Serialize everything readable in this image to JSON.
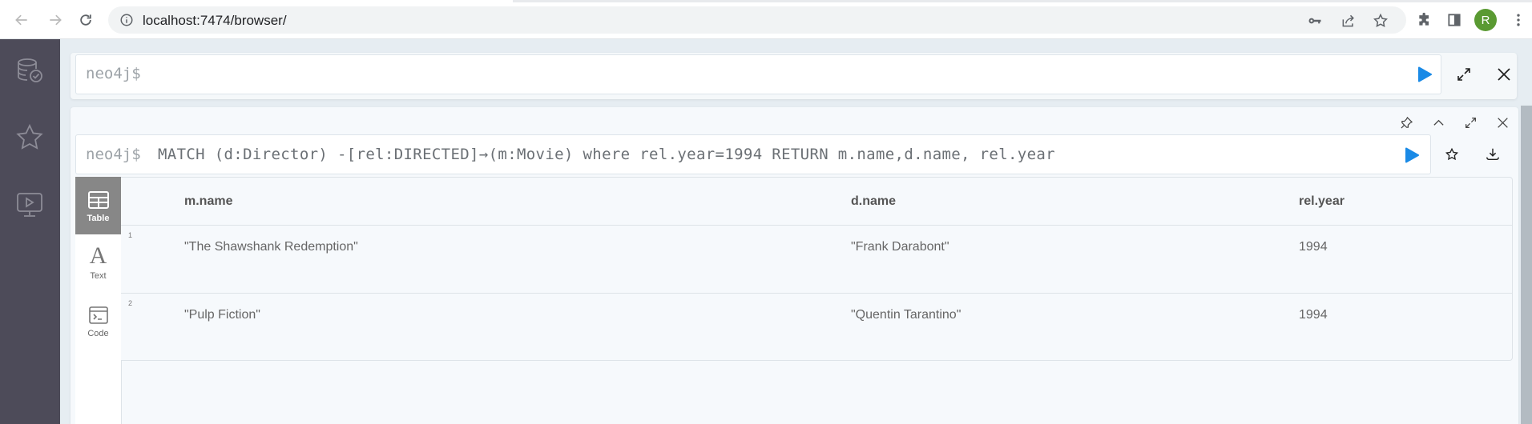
{
  "browser": {
    "url": "localhost:7474/browser/",
    "profile_initial": "R",
    "profile_color": "#5a9a32",
    "nav": {
      "back": "arrow-left-icon",
      "forward": "arrow-right-icon",
      "reload": "reload-icon"
    },
    "omnibox_actions": [
      "key-icon",
      "share-icon",
      "bookmark-star-icon"
    ],
    "toolbar": [
      "extensions-puzzle-icon",
      "side-panel-icon",
      "profile-avatar",
      "more-vert-icon"
    ]
  },
  "sidebar": {
    "items": [
      {
        "name": "database",
        "icon": "database-check-icon"
      },
      {
        "name": "favorites",
        "icon": "star-icon"
      },
      {
        "name": "guides",
        "icon": "monitor-play-icon"
      }
    ]
  },
  "editor": {
    "prompt": "neo4j$",
    "value": "",
    "run_color": "#1a8ae6"
  },
  "result_frame": {
    "prompt": "neo4j$",
    "query": "MATCH (d:Director) -[rel:DIRECTED]→(m:Movie) where rel.year=1994 RETURN m.name,d.name, rel.year",
    "header_actions": [
      "pin-icon",
      "collapse-chevron-icon",
      "fullscreen-icon",
      "close-icon"
    ],
    "query_actions": [
      "run-icon",
      "favorite-star-icon",
      "download-icon"
    ],
    "view_tabs": [
      {
        "label": "Table",
        "active": true
      },
      {
        "label": "Text",
        "active": false
      },
      {
        "label": "Code",
        "active": false
      }
    ],
    "table": {
      "columns": [
        "m.name",
        "d.name",
        "rel.year"
      ],
      "rows": [
        {
          "index": "1",
          "cells": [
            "\"The Shawshank Redemption\"",
            "\"Frank Darabont\"",
            "1994"
          ]
        },
        {
          "index": "2",
          "cells": [
            "\"Pulp Fiction\"",
            "\"Quentin Tarantino\"",
            "1994"
          ]
        }
      ]
    }
  }
}
